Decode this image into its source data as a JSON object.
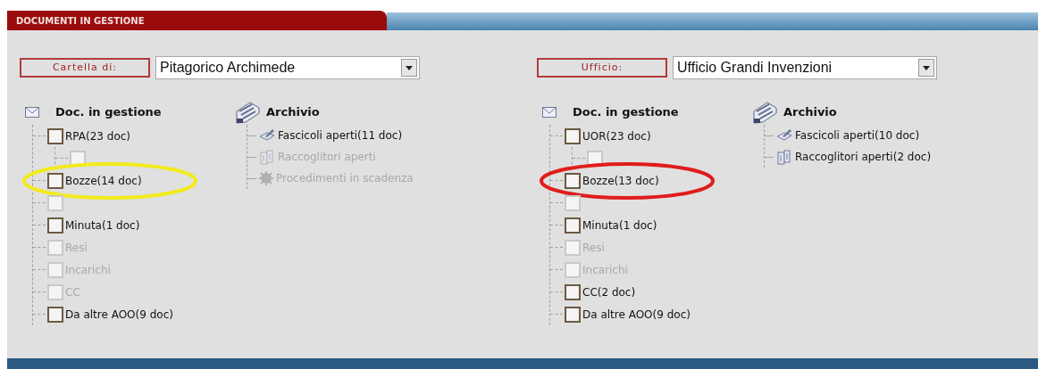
{
  "header": {
    "title": "DOCUMENTI IN GESTIONE"
  },
  "panels": [
    {
      "selector": {
        "label": "Cartella di:",
        "value": "Pitagorico Archimede"
      },
      "docs": {
        "title": "Doc. in gestione",
        "items": [
          {
            "label": "RPA(23 doc)",
            "disabled": false,
            "checked": false,
            "children": [
              {
                "disabled": true,
                "checked": false
              }
            ]
          },
          {
            "label": "Bozze(14 doc)",
            "disabled": false,
            "checked": false,
            "color": "#f2ea1c"
          },
          {
            "disabled": true,
            "checked": false
          },
          {
            "label": "Minuta(1 doc)",
            "disabled": false,
            "checked": false
          },
          {
            "label": "Resi",
            "disabled": true,
            "checked": false
          },
          {
            "label": "Incarichi",
            "disabled": true,
            "checked": false
          },
          {
            "label": "CC",
            "disabled": true,
            "checked": false
          },
          {
            "label": "Da altre AOO(9 doc)",
            "disabled": false,
            "checked": false
          }
        ]
      },
      "archive": {
        "title": "Archivio",
        "items": [
          {
            "kind": "folder",
            "label": "Fascicoli aperti(11 doc)",
            "disabled": false
          },
          {
            "kind": "binder",
            "label": "Raccoglitori aperti",
            "disabled": true
          },
          {
            "kind": "process",
            "label": "Procedimenti in scadenza",
            "disabled": true
          }
        ]
      }
    },
    {
      "selector": {
        "label": "Ufficio:",
        "value": "Ufficio Grandi Invenzioni"
      },
      "docs": {
        "title": "Doc. in gestione",
        "items": [
          {
            "label": "UOR(23 doc)",
            "disabled": false,
            "checked": false,
            "children": [
              {
                "disabled": true,
                "checked": false
              }
            ]
          },
          {
            "label": "Bozze(13 doc)",
            "disabled": false,
            "checked": false,
            "color": "#e01c1c"
          },
          {
            "disabled": true,
            "checked": false
          },
          {
            "label": "Minuta(1 doc)",
            "disabled": false,
            "checked": false
          },
          {
            "label": "Resi",
            "disabled": true,
            "checked": false
          },
          {
            "label": "Incarichi",
            "disabled": true,
            "checked": false
          },
          {
            "label": "CC(2 doc)",
            "disabled": false,
            "checked": false
          },
          {
            "label": "Da altre AOO(9 doc)",
            "disabled": false,
            "checked": false
          }
        ]
      },
      "archive": {
        "title": "Archivio",
        "items": [
          {
            "kind": "folder",
            "label": "Fascicoli aperti(10 doc)",
            "disabled": false
          },
          {
            "kind": "binder",
            "label": "Raccoglitori aperti(2 doc)",
            "disabled": false
          }
        ]
      }
    }
  ]
}
